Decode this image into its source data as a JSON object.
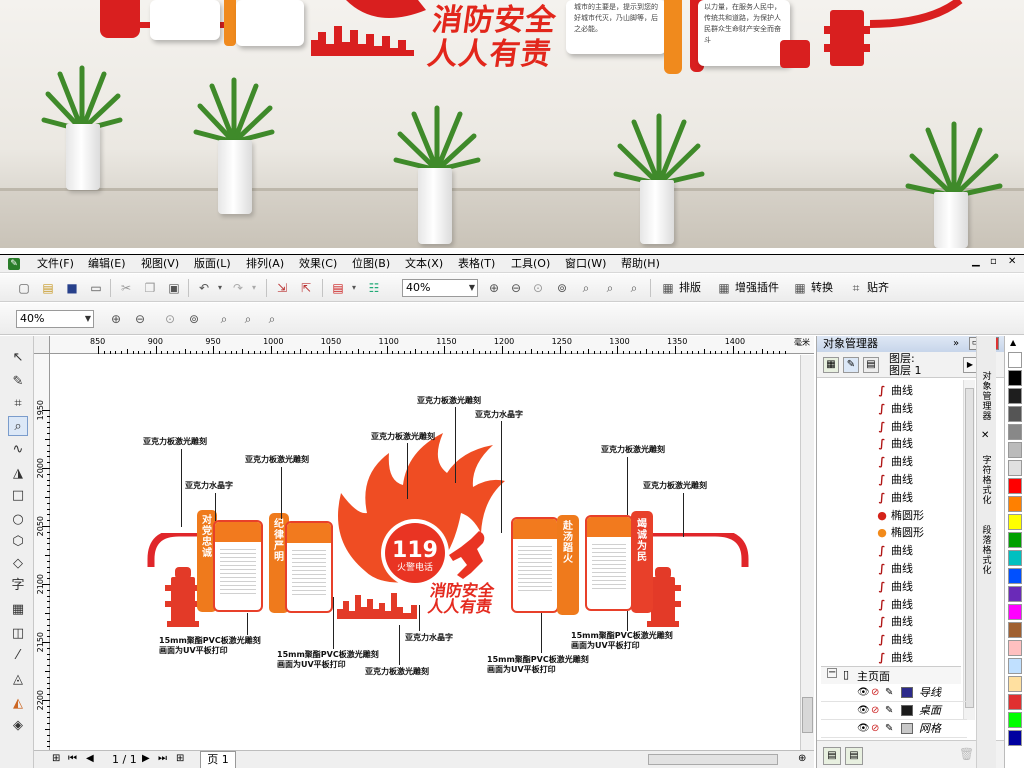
{
  "photo": {
    "title_line1": "消防安全",
    "title_line2": "人人有责",
    "panel_text_a": "城市的主要是，提示到您的好城市代灭，乃山脚等，后之必能。",
    "panel_text_b": "以力量，在服务人民中，传统共和道路，为保护人民群众生命财产安全而奋斗"
  },
  "menu": {
    "items": [
      "文件(F)",
      "编辑(E)",
      "视图(V)",
      "版面(L)",
      "排列(A)",
      "效果(C)",
      "位图(B)",
      "文本(X)",
      "表格(T)",
      "工具(O)",
      "窗口(W)",
      "帮助(H)"
    ]
  },
  "toolbar1": {
    "zoom_value": "40%",
    "btn_layout": "排版",
    "btn_plugin": "增强插件",
    "btn_convert": "转换",
    "btn_align": "贴齐"
  },
  "toolbar2": {
    "zoom_value": "40%"
  },
  "ruler": {
    "h_ticks": [
      "850",
      "900",
      "950",
      "1000",
      "1050",
      "1100",
      "1150",
      "1200",
      "1250",
      "1300",
      "1350",
      "1400"
    ],
    "unit": "毫米",
    "v_ticks": [
      "1950",
      "2000",
      "2050",
      "2100",
      "2150",
      "2200"
    ]
  },
  "design": {
    "phone": "119",
    "phone_label": "火警电话",
    "slogan_line1": "消防安全",
    "slogan_line2": "人人有责",
    "panel1": "对党忠诚",
    "panel2": "纪律严明",
    "panel3": "赴汤蹈火",
    "panel4": "竭诚为民"
  },
  "annotations": {
    "a1": "亚克力板激光雕刻",
    "a2": "亚克力水晶字",
    "a3": "亚克力板激光雕刻",
    "a4": "亚克力板激光雕刻",
    "a5": "亚克力板激光雕刻",
    "a6": "亚克力水晶字",
    "a7": "亚克力板激光雕刻",
    "a8": "亚克力板激光雕刻",
    "b1_line1": "15mm聚酯PVC板激光雕刻",
    "b1_line2": "画面为UV平板打印",
    "b2_line1": "15mm聚酯PVC板激光雕刻",
    "b2_line2": "画面为UV平板打印",
    "b3": "亚克力水晶字",
    "b4": "亚克力板激光雕刻",
    "b5_line1": "15mm聚酯PVC板激光雕刻",
    "b5_line2": "画面为UV平板打印",
    "b6_line1": "15mm聚酯PVC板激光雕刻",
    "b6_line2": "画面为UV平板打印"
  },
  "status": {
    "page_counter": "1 / 1",
    "page_tab": "页 1"
  },
  "object_manager": {
    "title": "对象管理器",
    "layer_label_1": "图层:",
    "layer_label_2": "图层 1",
    "items": [
      "曲线",
      "曲线",
      "曲线",
      "曲线",
      "曲线",
      "曲线",
      "曲线",
      "椭圆形",
      "椭圆形",
      "曲线",
      "曲线",
      "曲线",
      "曲线",
      "曲线",
      "曲线",
      "曲线"
    ],
    "master_page": "主页面",
    "layers": [
      "导线",
      "桌面",
      "网格"
    ],
    "colors": {
      "curve": "#b01515",
      "ellipse_red": "#d4231a",
      "ellipse_orange": "#f28a1a"
    }
  },
  "side_tabs": {
    "tab1": "对象管理器",
    "tab2": "字符格式化",
    "tab3": "段落格式化"
  },
  "palette": [
    "#ffffff",
    "#000000",
    "#1e1e1e",
    "#555555",
    "#888888",
    "#bbbbbb",
    "#e0e0e0",
    "#ff0000",
    "#ff8000",
    "#ffff00",
    "#00a000",
    "#00c0c0",
    "#0050ff",
    "#6a2ab8",
    "#ff00ff",
    "#a06030",
    "#ffc0c0",
    "#c0e0ff",
    "#ffe0a0",
    "#e03030",
    "#00ff00",
    "#0000a0"
  ]
}
